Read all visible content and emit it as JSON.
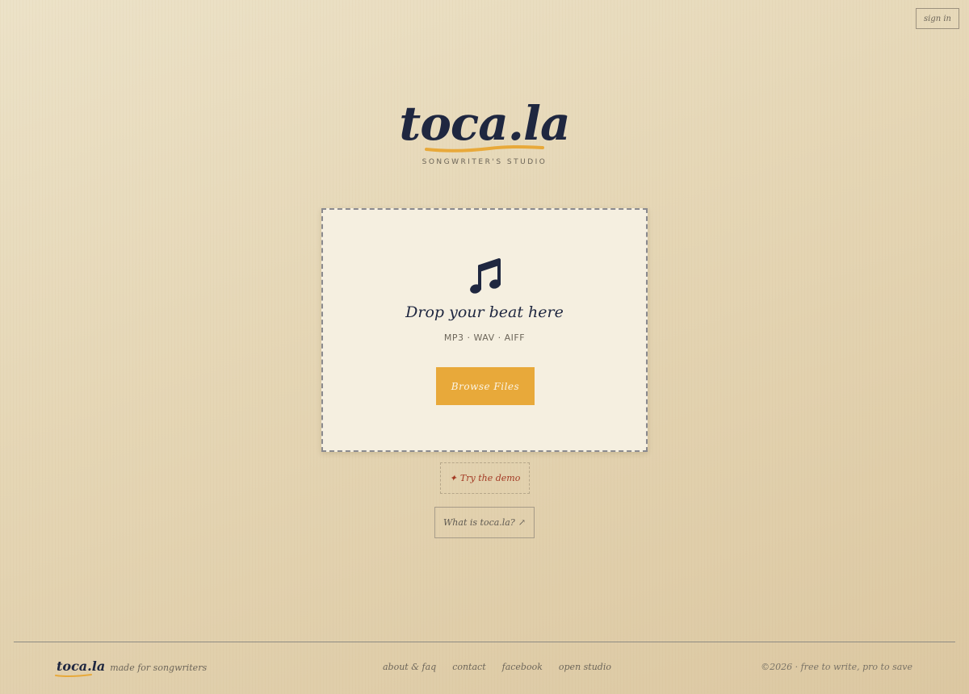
{
  "header": {
    "signin_label": "sign in"
  },
  "brand": {
    "logo": "toca.la",
    "tagline": "SONGWRITER'S STUDIO",
    "accent_color": "#e8a93a",
    "ink_color": "#1f2740"
  },
  "dropzone": {
    "icon": "music-note-icon",
    "title": "Drop your beat here",
    "formats": "MP3 · WAV · AIFF",
    "browse_label": "Browse Files"
  },
  "actions": {
    "demo_icon": "✦",
    "demo_label": "Try the demo",
    "whatis_label": "What is toca.la?",
    "whatis_icon": "↗"
  },
  "footer": {
    "logo": "toca.la",
    "tagline": "made for songwriters",
    "links": [
      "about & faq",
      "contact",
      "facebook",
      "open studio"
    ],
    "copyright": "©2026 · free to write, pro to save"
  }
}
